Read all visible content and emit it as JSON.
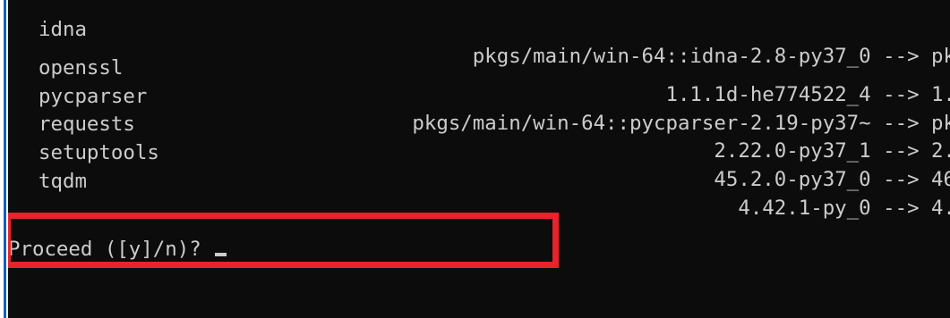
{
  "terminal": {
    "packages": [
      {
        "name": "idna",
        "change": "pkgs/main/win-64::idna-2.8-py37_0 --> pk"
      },
      {
        "name": "openssl",
        "change": "1.1.1d-he774522_4 --> 1."
      },
      {
        "name": "pycparser",
        "change": "pkgs/main/win-64::pycparser-2.19-py37~ --> pk"
      },
      {
        "name": "requests",
        "change": "2.22.0-py37_1 --> 2."
      },
      {
        "name": "setuptools",
        "change": "45.2.0-py37_0 --> 46"
      },
      {
        "name": "tqdm",
        "change": "4.42.1-py_0 --> 4."
      }
    ],
    "prompt": "Proceed ([y]/n)? "
  },
  "colors": {
    "background": "#0c0c0c",
    "text": "#cccccc",
    "highlight": "#e8232a",
    "window_edge": "#0a5fc8"
  }
}
